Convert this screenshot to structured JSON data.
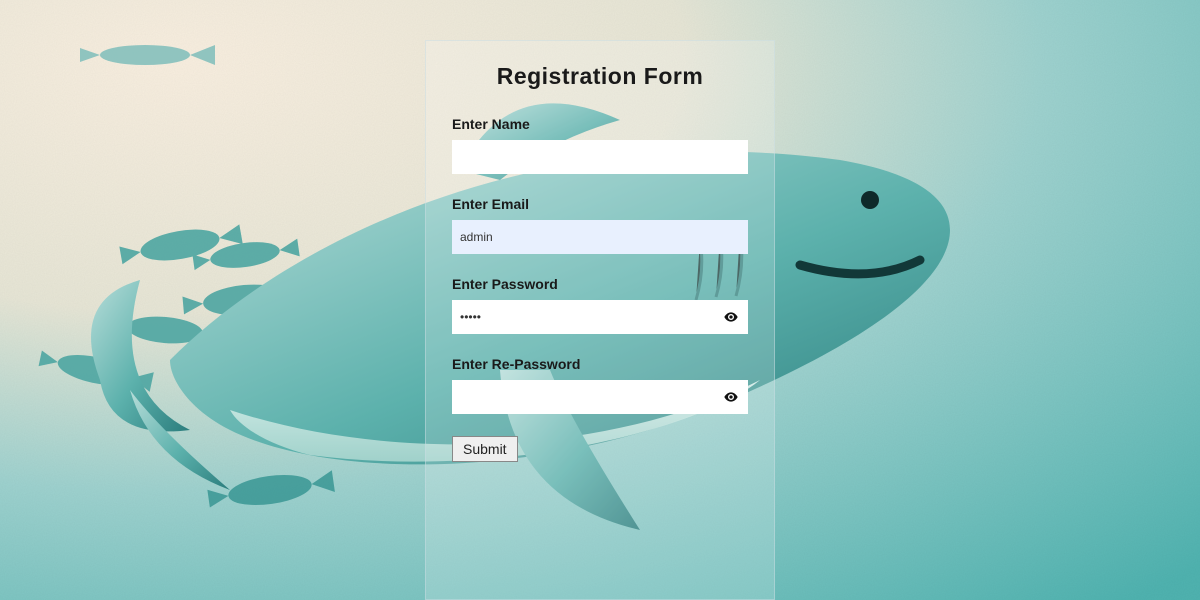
{
  "form": {
    "title": "Registration Form",
    "fields": {
      "name": {
        "label": "Enter Name",
        "value": ""
      },
      "email": {
        "label": "Enter Email",
        "value": "admin"
      },
      "password": {
        "label": "Enter Password",
        "value": "•••••"
      },
      "repassword": {
        "label": "Enter Re-Password",
        "value": ""
      }
    },
    "submit_label": "Submit"
  },
  "colors": {
    "card_bg": "rgba(255,255,255,0.18)",
    "autofill_bg": "#e8f0fe",
    "input_bg": "#ffffff",
    "button_bg": "#efefef"
  }
}
